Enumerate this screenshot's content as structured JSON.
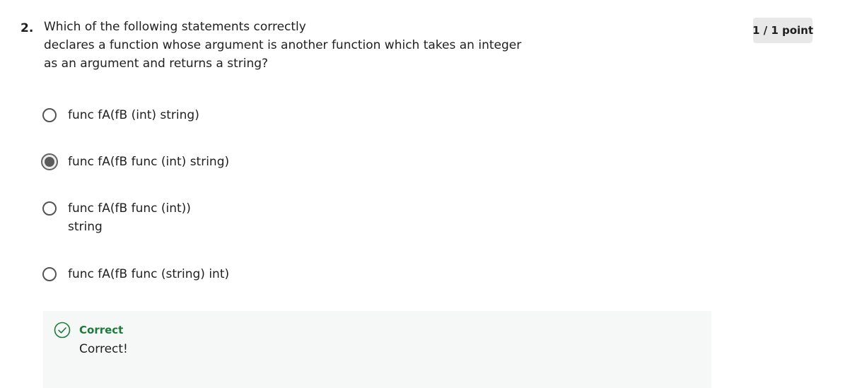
{
  "question": {
    "number": "2.",
    "text_lines": [
      "Which of the following statements correctly",
      "declares a function whose argument is another function which takes an integer",
      "as an argument and returns a string?"
    ],
    "points": "1 / 1 point"
  },
  "options": [
    {
      "lines": [
        "func fA(fB (int) string)"
      ],
      "selected": false
    },
    {
      "lines": [
        "func fA(fB func (int) string)"
      ],
      "selected": true
    },
    {
      "lines": [
        "func fA(fB func (int))",
        "string"
      ],
      "selected": false
    },
    {
      "lines": [
        "func fA(fB func (string) int)"
      ],
      "selected": false
    }
  ],
  "feedback": {
    "icon": "check-circle-icon",
    "status": "Correct",
    "message": "Correct!",
    "accent_color": "#1d7a3c"
  }
}
